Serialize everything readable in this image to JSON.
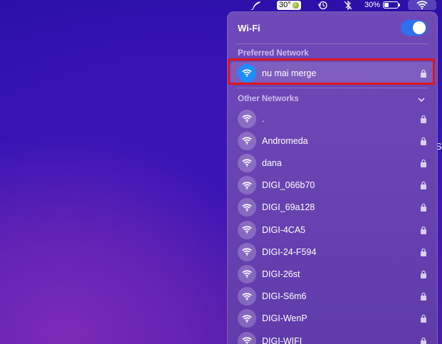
{
  "menubar": {
    "temperature": "30°",
    "battery_percent": "30%",
    "battery_level": 0.3
  },
  "edge_text": "S",
  "panel": {
    "title": "Wi-Fi",
    "wifi_enabled": true,
    "preferred_label": "Preferred Network",
    "other_label": "Other Networks",
    "preferred": [
      {
        "name": "nu mai merge",
        "locked": true,
        "connected": true
      }
    ],
    "others": [
      {
        "name": ".",
        "locked": true
      },
      {
        "name": "Andromeda",
        "locked": true
      },
      {
        "name": "dana",
        "locked": true
      },
      {
        "name": "DIGI_066b70",
        "locked": true
      },
      {
        "name": "DIGI_69a128",
        "locked": true
      },
      {
        "name": "DIGI-4CA5",
        "locked": true
      },
      {
        "name": "DIGI-24-F594",
        "locked": true
      },
      {
        "name": "DIGI-26st",
        "locked": true
      },
      {
        "name": "DIGI-S6m6",
        "locked": true
      },
      {
        "name": "DIGI-WenP",
        "locked": true
      },
      {
        "name": "DIGI-WIFI",
        "locked": true
      }
    ]
  },
  "colors": {
    "accent": "#2f6ff0",
    "connected_icon": "#1e8cff",
    "annotation": "#e0141e"
  }
}
